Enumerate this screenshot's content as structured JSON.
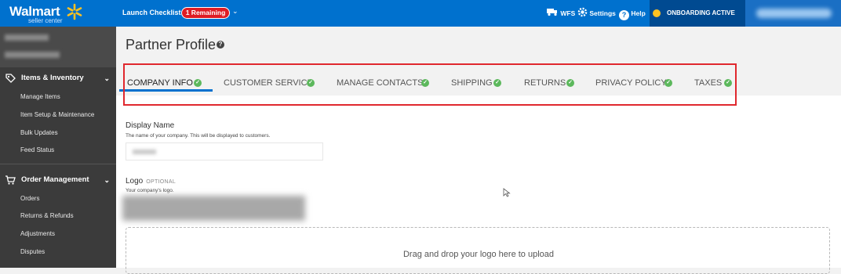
{
  "brand": {
    "name": "Walmart",
    "subtitle": "seller center"
  },
  "topbar": {
    "launch_label": "Launch Checklist",
    "remaining_badge": "1 Remaining",
    "wfs_label": "WFS",
    "settings_label": "Settings",
    "help_label": "Help",
    "onboarding_label": "ONBOARDING ACTIVE"
  },
  "sidebar": {
    "sections": [
      {
        "label": "Items & Inventory",
        "icon": "tag-icon",
        "items": [
          "Manage Items",
          "Item Setup & Maintenance",
          "Bulk Updates",
          "Feed Status"
        ]
      },
      {
        "label": "Order Management",
        "icon": "cart-icon",
        "items": [
          "Orders",
          "Returns & Refunds",
          "Adjustments",
          "Disputes"
        ]
      }
    ]
  },
  "page": {
    "title": "Partner Profile"
  },
  "tabs": [
    {
      "label": "COMPANY INFO",
      "active": true
    },
    {
      "label": "CUSTOMER SERVICE"
    },
    {
      "label": "MANAGE CONTACTS"
    },
    {
      "label": "SHIPPING"
    },
    {
      "label": "RETURNS"
    },
    {
      "label": "PRIVACY POLICY"
    },
    {
      "label": "TAXES"
    }
  ],
  "form": {
    "display_name_label": "Display Name",
    "display_name_hint": "The name of your company. This will be displayed to customers.",
    "logo_label": "Logo",
    "logo_optional": "OPTIONAL",
    "logo_hint": "Your company's logo.",
    "dropzone_text": "Drag and drop your logo here to upload"
  },
  "colors": {
    "brand_blue": "#0071ce",
    "check_green": "#5cb85c",
    "badge_red": "#de1c24",
    "highlight_red": "#e0282e",
    "spark_yellow": "#ffc220"
  }
}
